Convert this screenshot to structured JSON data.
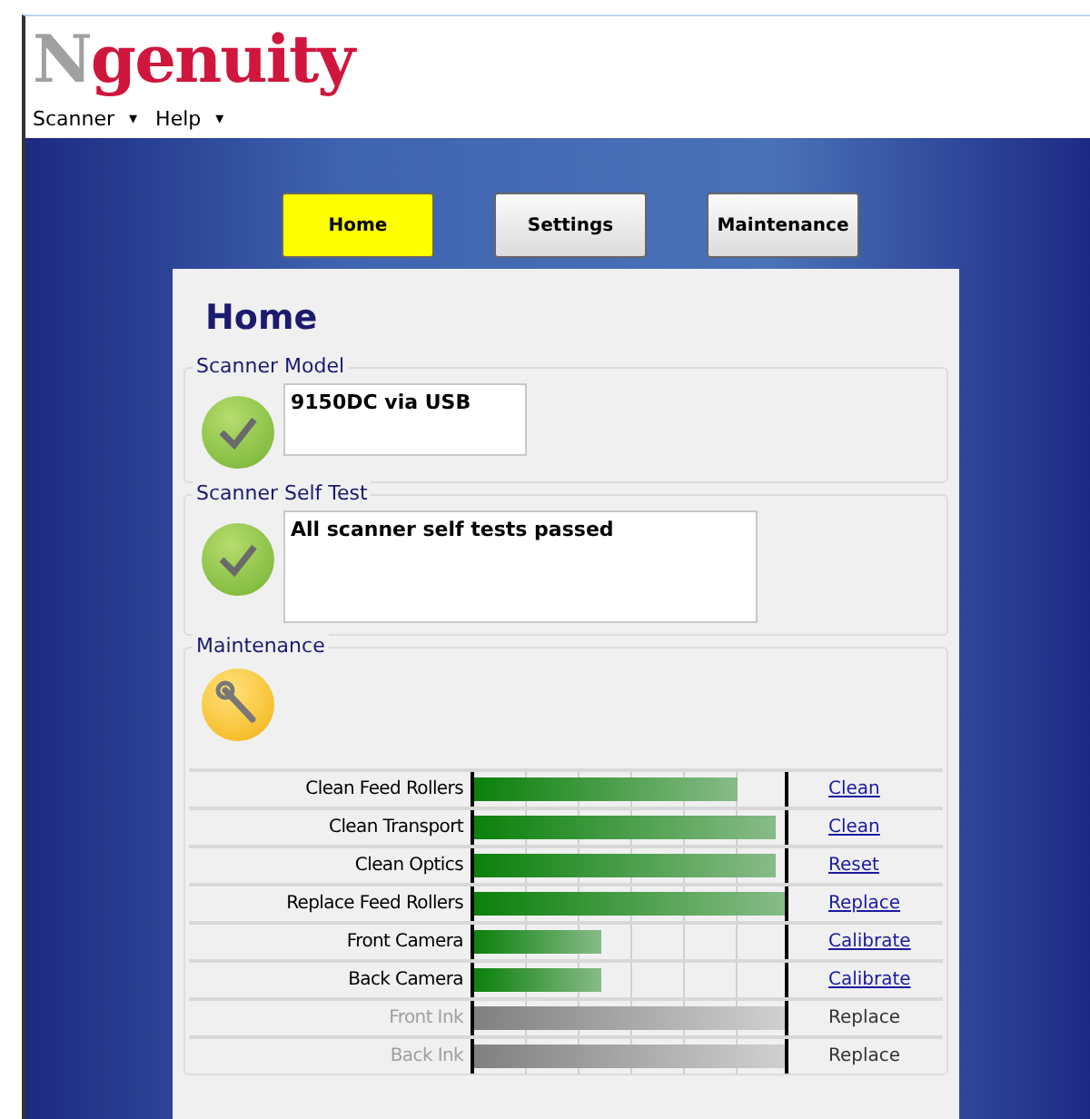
{
  "logo": {
    "prefix": "N",
    "rest": "genuity"
  },
  "menu": [
    {
      "label": "Scanner",
      "caret": "▾"
    },
    {
      "label": "Help",
      "caret": "▾"
    }
  ],
  "tabs": [
    {
      "label": "Home",
      "selected": true
    },
    {
      "label": "Settings",
      "selected": false
    },
    {
      "label": "Maintenance",
      "selected": false
    }
  ],
  "page_title": "Home",
  "scanner_model": {
    "heading": "Scanner Model",
    "passed": true,
    "value": "9150DC via USB"
  },
  "self_test": {
    "heading": "Scanner Self Test",
    "passed": true,
    "value": "All scanner self tests passed"
  },
  "maintenance": {
    "heading": "Maintenance",
    "items": [
      {
        "label": "Clean Feed Rollers",
        "level": 0.85,
        "action": "Clean",
        "disabled": false
      },
      {
        "label": "Clean Transport",
        "level": 0.97,
        "action": "Clean",
        "disabled": false
      },
      {
        "label": "Clean Optics",
        "level": 0.97,
        "action": "Reset",
        "disabled": false
      },
      {
        "label": "Replace Feed Rollers",
        "level": 1.0,
        "action": "Replace",
        "disabled": false
      },
      {
        "label": "Front Camera",
        "level": 0.41,
        "action": "Calibrate",
        "disabled": false
      },
      {
        "label": "Back Camera",
        "level": 0.41,
        "action": "Calibrate",
        "disabled": false
      },
      {
        "label": "Front Ink",
        "level": 1.0,
        "action": "Replace",
        "disabled": true
      },
      {
        "label": "Back Ink",
        "level": 1.0,
        "action": "Replace",
        "disabled": true
      }
    ]
  }
}
